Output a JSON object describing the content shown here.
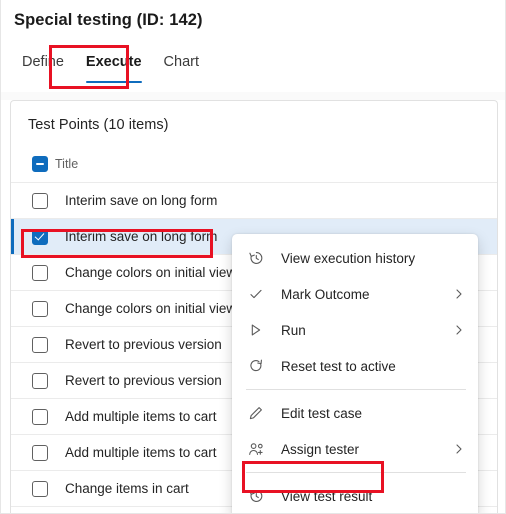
{
  "header": {
    "title": "Special testing (ID: 142)"
  },
  "tabs": [
    {
      "label": "Define",
      "active": false
    },
    {
      "label": "Execute",
      "active": true
    },
    {
      "label": "Chart",
      "active": false
    }
  ],
  "panel": {
    "title": "Test Points (10 items)",
    "grid_header": {
      "column_label": "Title",
      "select_all_state": "indeterminate"
    },
    "rows": [
      {
        "label": "Interim save on long form",
        "checked": false,
        "selected": false
      },
      {
        "label": "Interim save on long form",
        "checked": true,
        "selected": true
      },
      {
        "label": "Change colors on initial view",
        "checked": false,
        "selected": false
      },
      {
        "label": "Change colors on initial view",
        "checked": false,
        "selected": false
      },
      {
        "label": "Revert to previous version",
        "checked": false,
        "selected": false
      },
      {
        "label": "Revert to previous version",
        "checked": false,
        "selected": false
      },
      {
        "label": "Add multiple items to cart",
        "checked": false,
        "selected": false
      },
      {
        "label": "Add multiple items to cart",
        "checked": false,
        "selected": false
      },
      {
        "label": "Change items in cart",
        "checked": false,
        "selected": false
      }
    ]
  },
  "context_menu": {
    "items": [
      {
        "label": "View execution history",
        "icon": "history-icon",
        "submenu": false,
        "type": "item"
      },
      {
        "label": "Mark Outcome",
        "icon": "checkmark-icon",
        "submenu": true,
        "type": "item"
      },
      {
        "label": "Run",
        "icon": "play-icon",
        "submenu": true,
        "type": "item"
      },
      {
        "label": "Reset test to active",
        "icon": "refresh-icon",
        "submenu": false,
        "type": "item"
      },
      {
        "type": "divider"
      },
      {
        "label": "Edit test case",
        "icon": "pencil-icon",
        "submenu": false,
        "type": "item"
      },
      {
        "label": "Assign tester",
        "icon": "person-add-icon",
        "submenu": true,
        "type": "item"
      },
      {
        "type": "divider"
      },
      {
        "label": "View test result",
        "icon": "history-icon",
        "submenu": false,
        "type": "item",
        "highlighted": true
      }
    ]
  },
  "annotations": {
    "highlight_color": "#e81123",
    "boxes": [
      {
        "name": "execute-tab-highlight"
      },
      {
        "name": "selected-row-highlight"
      },
      {
        "name": "view-test-result-highlight"
      }
    ]
  },
  "colors": {
    "accent": "#0f6cbd",
    "selected_row_bg": "#e1ecf8",
    "highlight": "#e81123",
    "text_primary": "#242424",
    "text_secondary": "#616161"
  }
}
